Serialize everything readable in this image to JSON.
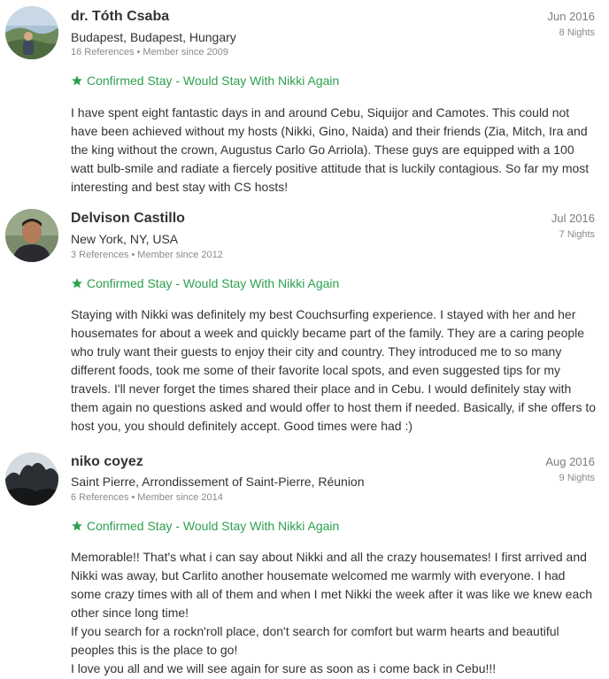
{
  "reviews": [
    {
      "name": "dr. Tóth Csaba",
      "location": "Budapest, Budapest, Hungary",
      "references": "16 References",
      "member_since": "Member since 2009",
      "date": "Jun 2016",
      "nights": "8 Nights",
      "confirmation": "Confirmed Stay - Would Stay With Nikki Again",
      "paragraphs": [
        "I have spent eight fantastic days in and around Cebu, Siquijor and Camotes. This could not have been achieved without my hosts (Nikki, Gino, Naida) and their friends (Zia, Mitch, Ira and the king without the crown, Augustus Carlo Go Arriola). These guys are equipped with a 100 watt bulb-smile and radiate a fiercely positive attitude that is luckily contagious. So far my most interesting and best stay with CS hosts!"
      ]
    },
    {
      "name": "Delvison Castillo",
      "location": "New York, NY, USA",
      "references": "3 References",
      "member_since": "Member since 2012",
      "date": "Jul 2016",
      "nights": "7 Nights",
      "confirmation": "Confirmed Stay - Would Stay With Nikki Again",
      "paragraphs": [
        "Staying with Nikki was definitely my best Couchsurfing experience. I stayed with her and her housemates for about a week and quickly became part of the family. They are a caring people who truly want their guests to enjoy their city and country. They introduced me to so many different foods, took me some of their favorite local spots, and even suggested tips for my travels. I'll never forget the times shared their place and in Cebu. I would definitely stay with them again no questions asked and would offer to host them if needed. Basically, if she offers to host you, you should definitely accept. Good times were had :)"
      ]
    },
    {
      "name": "niko coyez",
      "location": "Saint Pierre, Arrondissement of Saint-Pierre, Réunion",
      "references": "6 References",
      "member_since": "Member since 2014",
      "date": "Aug 2016",
      "nights": "9 Nights",
      "confirmation": "Confirmed Stay - Would Stay With Nikki Again",
      "paragraphs": [
        "Memorable!! That's what i can say about Nikki and all the crazy housemates! I first arrived and Nikki was away, but Carlito another housemate welcomed me warmly with everyone. I had some crazy times with all of them and when I met Nikki the week after it was like we knew each other since long time!",
        "If you search for a rockn'roll place, don't search for comfort but warm hearts and beautiful peoples this is the place to go!",
        "I love you all and we will see again for sure as soon as i come back in Cebu!!!"
      ]
    }
  ],
  "colors": {
    "confirm_green": "#2ea04f",
    "meta_gray": "#8a8a8a",
    "text": "#333333"
  },
  "icons": {
    "confirm": "star-icon"
  }
}
